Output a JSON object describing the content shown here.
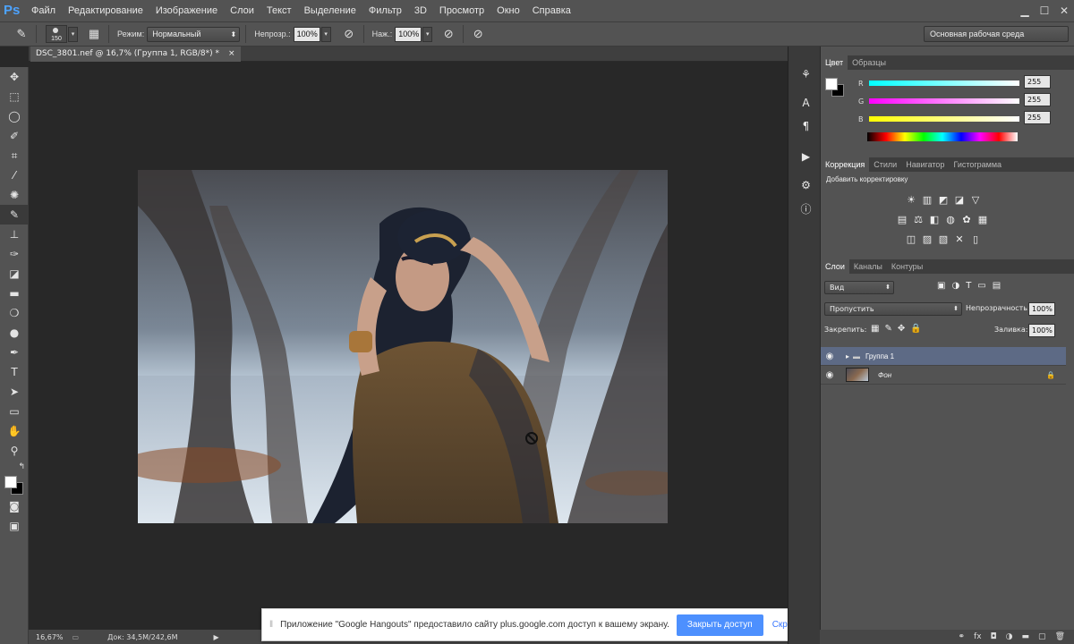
{
  "app": {
    "logo": "Ps"
  },
  "menu": [
    "Файл",
    "Редактирование",
    "Изображение",
    "Слои",
    "Текст",
    "Выделение",
    "Фильтр",
    "3D",
    "Просмотр",
    "Окно",
    "Справка"
  ],
  "window_controls": {
    "minimize": "▁",
    "maximize": "☐",
    "close": "✕"
  },
  "options": {
    "brush_size": "150",
    "mode_label": "Режим:",
    "mode_value": "Нормальный",
    "opacity_label": "Непрозр.:",
    "opacity_value": "100%",
    "pressure_label": "Наж.:",
    "pressure_value": "100%",
    "workspace": "Основная рабочая среда"
  },
  "document": {
    "tab_title": "DSC_3801.nef @ 16,7% (Группа 1, RGB/8*) *",
    "close": "×"
  },
  "status": {
    "zoom": "16,67%",
    "doc_label": "Док: 34,5M/242,6M"
  },
  "color_panel": {
    "tabs": [
      "Цвет",
      "Образцы"
    ],
    "channels": [
      {
        "name": "R",
        "value": "255"
      },
      {
        "name": "G",
        "value": "255"
      },
      {
        "name": "B",
        "value": "255"
      }
    ]
  },
  "adjustments_panel": {
    "tabs": [
      "Коррекция",
      "Стили",
      "Навигатор",
      "Гистограмма"
    ],
    "title": "Добавить корректировку"
  },
  "layers_panel": {
    "tabs": [
      "Слои",
      "Каналы",
      "Контуры"
    ],
    "filter_kind": "Вид",
    "blend_mode": "Пропустить",
    "opacity_label": "Непрозрачность:",
    "opacity_value": "100%",
    "lock_label": "Закрепить:",
    "fill_label": "Заливка:",
    "fill_value": "100%",
    "layers": [
      {
        "name": "Группа 1",
        "type": "group",
        "selected": true
      },
      {
        "name": "Фон",
        "type": "background",
        "locked": true
      }
    ]
  },
  "notification": {
    "message": "Приложение \"Google Hangouts\" предоставило сайту plus.google.com доступ к вашему экрану.",
    "primary_button": "Закрыть доступ",
    "secondary_button": "Скрыть"
  },
  "colors": {
    "accent": "#4d90fe",
    "ui_bg": "#535353",
    "canvas_bg": "#282828",
    "selected_layer": "#5d6a85"
  }
}
